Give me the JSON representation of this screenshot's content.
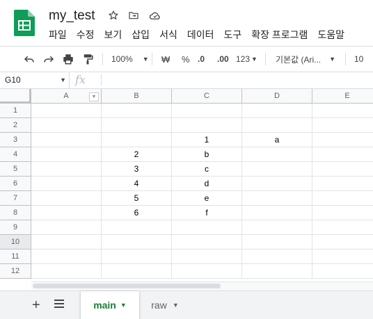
{
  "document": {
    "title": "my_test"
  },
  "menu": [
    "파일",
    "수정",
    "보기",
    "삽입",
    "서식",
    "데이터",
    "도구",
    "확장 프로그램",
    "도움말"
  ],
  "toolbar": {
    "zoom": "100%",
    "currency": "₩",
    "percent": "%",
    "decrease_decimal": ".0",
    "increase_decimal": ".00",
    "number_format": "123",
    "font": "기본값 (Ari...",
    "font_size": "10"
  },
  "formula_bar": {
    "name_box": "G10",
    "fx": "fx",
    "value": ""
  },
  "columns": [
    "A",
    "B",
    "C",
    "D",
    "E"
  ],
  "rows": [
    "1",
    "2",
    "3",
    "4",
    "5",
    "6",
    "7",
    "8",
    "9",
    "10",
    "11",
    "12"
  ],
  "cells": [
    [
      "",
      "",
      "",
      "",
      ""
    ],
    [
      "",
      "",
      "",
      "",
      ""
    ],
    [
      "",
      "",
      "1",
      "a",
      ""
    ],
    [
      "",
      "2",
      "b",
      "",
      ""
    ],
    [
      "",
      "3",
      "c",
      "",
      ""
    ],
    [
      "",
      "4",
      "d",
      "",
      ""
    ],
    [
      "",
      "5",
      "e",
      "",
      ""
    ],
    [
      "",
      "6",
      "f",
      "",
      ""
    ],
    [
      "",
      "",
      "",
      "",
      ""
    ],
    [
      "",
      "",
      "",
      "",
      ""
    ],
    [
      "",
      "",
      "",
      "",
      ""
    ],
    [
      "",
      "",
      "",
      "",
      ""
    ]
  ],
  "sheets": [
    {
      "name": "main",
      "active": true
    },
    {
      "name": "raw",
      "active": false
    }
  ],
  "colors": {
    "accent": "#188038",
    "logo": "#0f9d58"
  }
}
